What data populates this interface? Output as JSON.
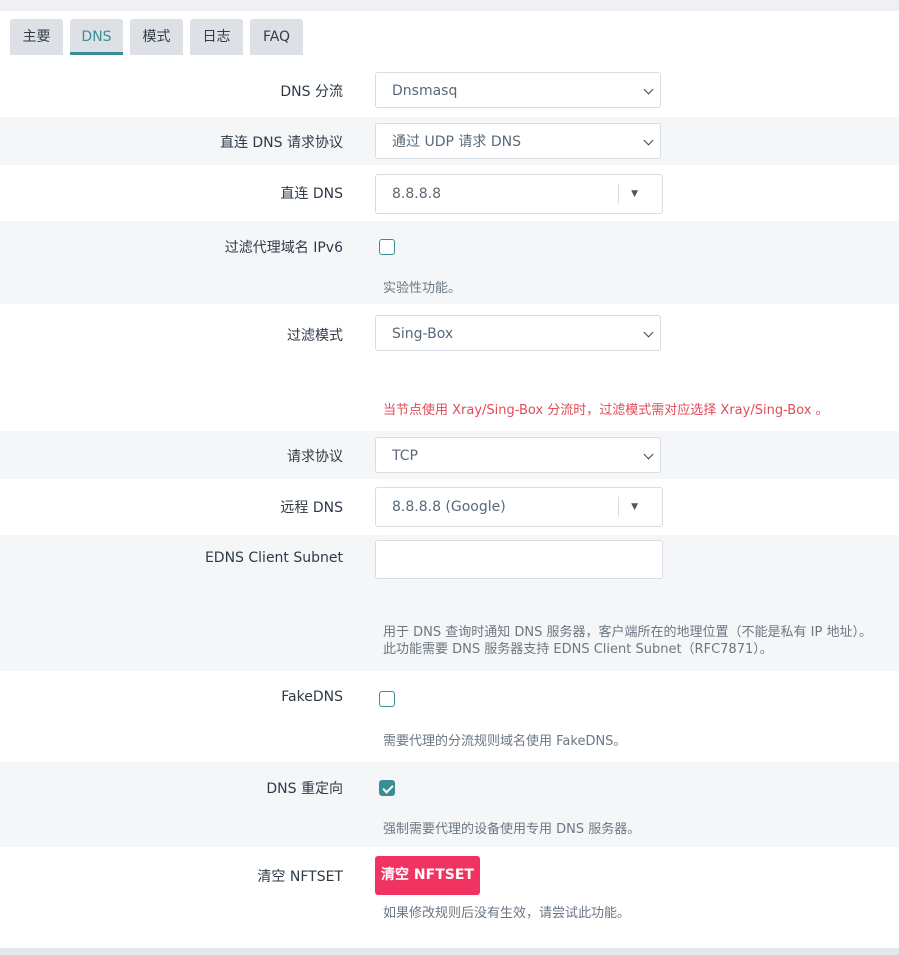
{
  "tabs": [
    {
      "label": "主要",
      "active": false
    },
    {
      "label": "DNS",
      "active": true
    },
    {
      "label": "模式",
      "active": false
    },
    {
      "label": "日志",
      "active": false
    },
    {
      "label": "FAQ",
      "active": false
    }
  ],
  "fields": {
    "dns_shunt": {
      "label": "DNS 分流",
      "value": "Dnsmasq"
    },
    "direct_protocol": {
      "label": "直连 DNS 请求协议",
      "value": "通过 UDP 请求 DNS"
    },
    "direct_dns": {
      "label": "直连 DNS",
      "value": "8.8.8.8"
    },
    "filter_ipv6": {
      "label": "过滤代理域名 IPv6",
      "checked": false,
      "description": "实验性功能。"
    },
    "filter_mode": {
      "label": "过滤模式",
      "value": "Sing-Box",
      "description": "当节点使用 Xray/Sing-Box 分流时，过滤模式需对应选择 Xray/Sing-Box 。"
    },
    "request_protocol": {
      "label": "请求协议",
      "value": "TCP"
    },
    "remote_dns": {
      "label": "远程 DNS",
      "value": "8.8.8.8 (Google)"
    },
    "edns": {
      "label": "EDNS Client Subnet",
      "value": "",
      "description_line1": "用于 DNS 查询时通知 DNS 服务器，客户端所在的地理位置（不能是私有 IP 地址）。",
      "description_line2": "此功能需要 DNS 服务器支持 EDNS Client Subnet（RFC7871）。"
    },
    "fakedns": {
      "label": "FakeDNS",
      "checked": false,
      "description": "需要代理的分流规则域名使用 FakeDNS。"
    },
    "dns_redirect": {
      "label": "DNS 重定向",
      "checked": true,
      "description": "强制需要代理的设备使用专用 DNS 服务器。"
    },
    "clear_nftset": {
      "label": "清空 NFTSET",
      "button": "清空 NFTSET",
      "description": "如果修改规则后没有生效，请尝试此功能。"
    }
  },
  "colors": {
    "accent": "#3a8f95",
    "danger_button": "#f03360",
    "warning_text": "#e24b5a"
  }
}
